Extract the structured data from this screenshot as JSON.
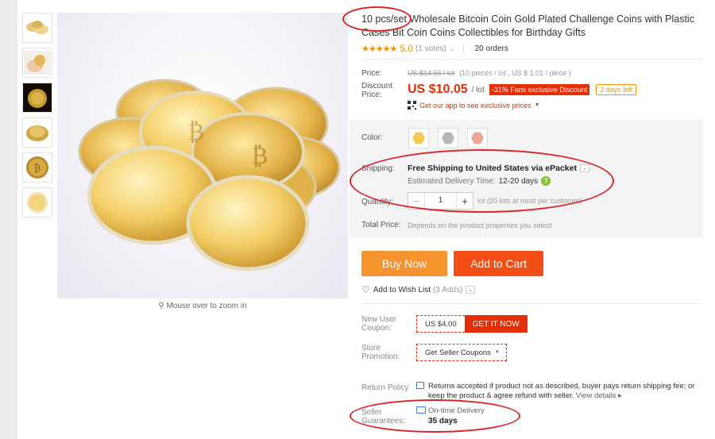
{
  "product": {
    "title": "10 pcs/set Wholesale Bitcoin Coin Gold Plated Challenge Coins with Plastic Cases Bit Coin Coins Collectibles for Birthday Gifts",
    "stars": "★★★★★",
    "rating": "5.0",
    "votes": "(1 votes)",
    "orders": "20 orders",
    "zoom_hint": "Mouse over to zoom in"
  },
  "price": {
    "label": "Price:",
    "original": "US $14.56 / lot",
    "original_detail": "(10 pieces / lot , US $ 1.01 / piece )",
    "discount_label": "Discount Price:",
    "value": "US $10.05",
    "unit": "/ lot",
    "discount_badge": "-31% Fans exclusive Discount",
    "days_left": "2 days left",
    "app_promo": "Get our app to see exclusive prices"
  },
  "options": {
    "color_label": "Color:",
    "color_swatches": [
      "gold",
      "silver",
      "rose"
    ],
    "shipping_label": "Shipping:",
    "shipping_value": "Free Shipping to United States via ePacket",
    "delivery_label": "Estimated Delivery Time:",
    "delivery_value": "12-20 days",
    "quantity_label": "Quantity:",
    "quantity_value": "1",
    "quantity_minus": "−",
    "quantity_plus": "+",
    "quantity_note": "lot (20 lots at most per customer)",
    "total_label": "Total Price:",
    "total_value": "Depends on the product properties you select"
  },
  "actions": {
    "buy_now": "Buy Now",
    "add_to_cart": "Add to Cart",
    "wishlist": "Add to Wish List",
    "wishlist_count": "(3 Adds)"
  },
  "coupons": {
    "new_user_label": "New User Coupon:",
    "coupon_value": "US $4.00",
    "coupon_cta": "GET IT NOW",
    "store_label": "Store Promotion:",
    "seller_coupons": "Get Seller Coupons"
  },
  "policy": {
    "return_label": "Return Policy",
    "return_text": "Returns accepted if product not as described, buyer pays return shipping fee; or keep the product & agree refund with seller.",
    "view_details": "View details",
    "guarantee_label": "Seller Guarantees:",
    "guarantee_title": "On-time Delivery",
    "guarantee_days": "35 days"
  },
  "colors": {
    "accent_orange": "#f29200",
    "price_red": "#e62e04",
    "buy_now": "#f7932e",
    "add_to_cart": "#f24e16",
    "annotation_red": "#d9262b"
  },
  "icons": [
    "zoom-icon",
    "qr-code-icon",
    "help-icon",
    "heart-icon",
    "return-policy-icon",
    "truck-icon"
  ]
}
